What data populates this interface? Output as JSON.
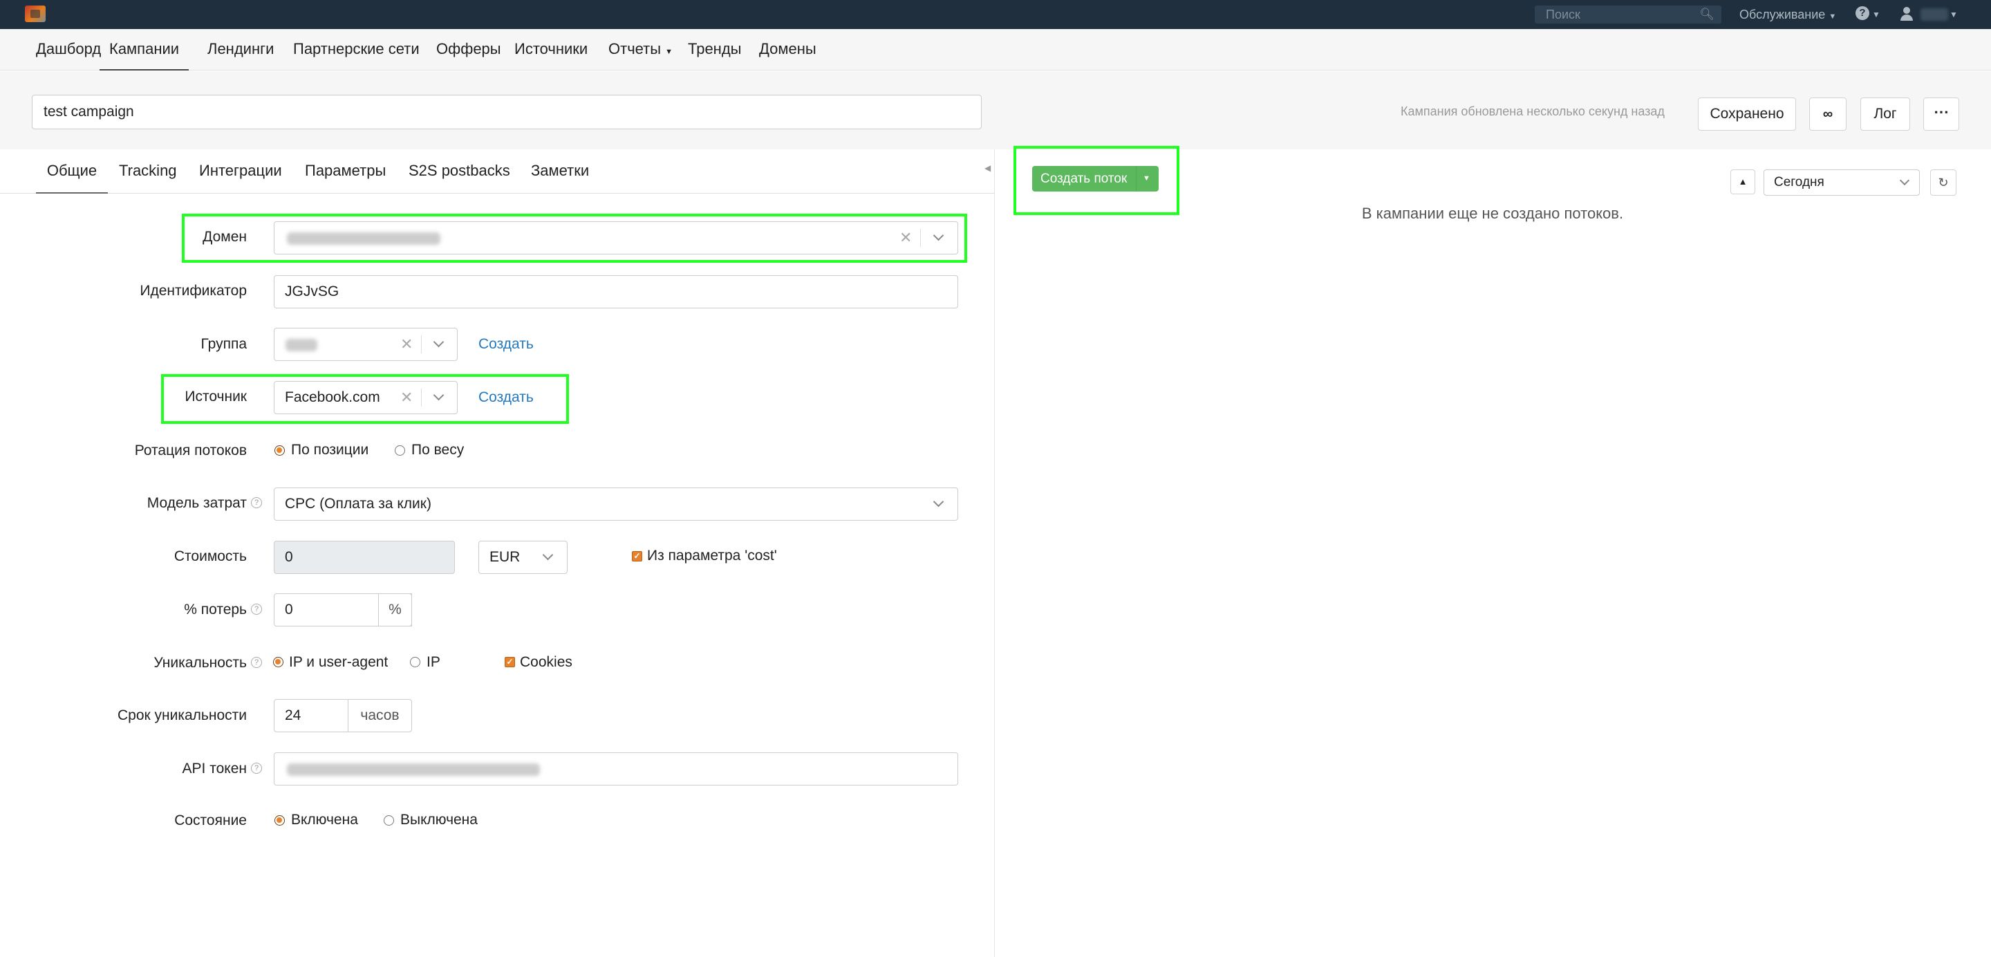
{
  "topbar": {
    "search_placeholder": "Поиск",
    "service_label": "Обслуживание",
    "help_icon": "question-circle-icon",
    "user_icon": "user-icon"
  },
  "nav": {
    "items": [
      "Дашборд",
      "Кампании",
      "Лендинги",
      "Партнерские сети",
      "Офферы",
      "Источники",
      "Отчеты",
      "Тренды",
      "Домены"
    ],
    "active": "Кампании"
  },
  "campaign": {
    "name": "test campaign",
    "update_status": "Кампания обновлена несколько секунд назад",
    "saved_label": "Сохранено",
    "log_label": "Лог"
  },
  "tabs": {
    "items": [
      "Общие",
      "Tracking",
      "Интеграции",
      "Параметры",
      "S2S postbacks",
      "Заметки"
    ],
    "active": "Общие"
  },
  "form": {
    "domain_label": "Домен",
    "identifier_label": "Идентификатор",
    "identifier_value": "JGJvSG",
    "group_label": "Группа",
    "group_create": "Создать",
    "source_label": "Источник",
    "source_value": "Facebook.com",
    "source_create": "Создать",
    "rotation_label": "Ротация потоков",
    "rotation_options": [
      "По позиции",
      "По весу"
    ],
    "rotation_selected": "По позиции",
    "cost_model_label": "Модель затрат",
    "cost_model_value": "CPC (Оплата за клик)",
    "cost_label": "Стоимость",
    "cost_value": "0",
    "currency_value": "EUR",
    "cost_param_label": "Из параметра 'cost'",
    "cost_param_checked": true,
    "loss_label": "% потерь",
    "loss_value": "0",
    "loss_unit": "%",
    "uniq_label": "Уникальность",
    "uniq_options": [
      "IP и user-agent",
      "IP"
    ],
    "uniq_selected": "IP и user-agent",
    "cookies_label": "Cookies",
    "cookies_checked": true,
    "uniq_period_label": "Срок уникальности",
    "uniq_period_value": "24",
    "uniq_period_unit": "часов",
    "api_token_label": "API токен",
    "state_label": "Состояние",
    "state_options": [
      "Включена",
      "Выключена"
    ],
    "state_selected": "Включена"
  },
  "streams": {
    "create_button": "Создать поток",
    "period_value": "Сегодня",
    "empty_message": "В кампании еще не создано потоков."
  },
  "colors": {
    "topbar": "#1f2f3d",
    "accent_orange": "#e8822a",
    "create_green": "#5cb85c",
    "highlight": "#22ff22",
    "link": "#2779bd"
  }
}
